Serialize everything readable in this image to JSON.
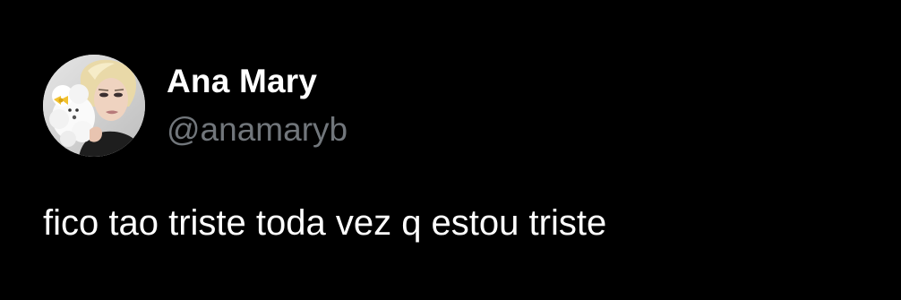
{
  "tweet": {
    "author": {
      "display_name": "Ana Mary",
      "handle": "@anamaryb",
      "avatar_icon": "profile-photo-avatar"
    },
    "text": "fico tao triste toda vez q estou triste"
  },
  "colors": {
    "background": "#000000",
    "display_name": "#ffffff",
    "handle": "#71767b",
    "text": "#ffffff"
  }
}
